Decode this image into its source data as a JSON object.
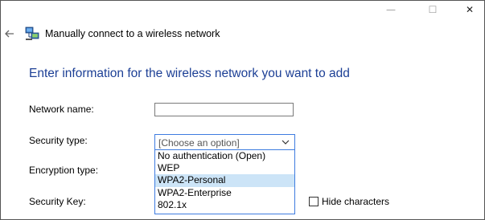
{
  "window": {
    "controls": {
      "minimize": "—",
      "maximize": "☐",
      "close": "✕"
    },
    "back_icon": "back-arrow-icon",
    "network_icon": "network-icon",
    "title": "Manually connect to a wireless network"
  },
  "main": {
    "instruction": "Enter information for the wireless network you want to add"
  },
  "form": {
    "network_name": {
      "label": "Network name:",
      "value": ""
    },
    "security_type": {
      "label": "Security type:",
      "value": "[Choose an option]",
      "options": [
        "No authentication (Open)",
        "WEP",
        "WPA2-Personal",
        "WPA2-Enterprise",
        "802.1x"
      ],
      "highlighted_option": "WPA2-Personal"
    },
    "encryption_type": {
      "label": "Encryption type:"
    },
    "security_key": {
      "label": "Security Key:"
    },
    "hide_characters": {
      "label": "Hide characters",
      "checked": false
    }
  },
  "colors": {
    "instruction_text": "#1c3f95",
    "focus_border": "#3e7ce0",
    "highlight": "#cce4f7"
  }
}
